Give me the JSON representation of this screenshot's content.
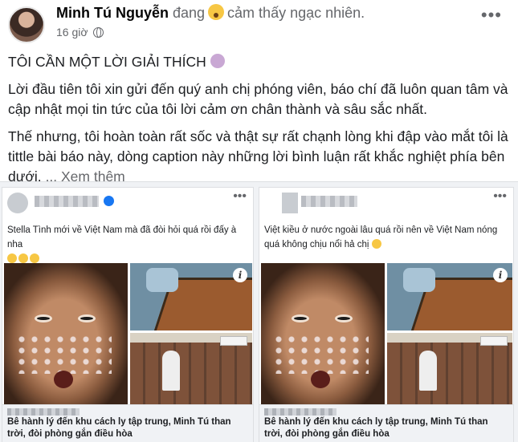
{
  "post": {
    "author": "Minh Tú Nguyễn",
    "feeling_prefix": "đang",
    "feeling_text": "cảm thấy ngạc nhiên.",
    "time": "16 giờ",
    "title": "TÔI CẦN MỘT LỜI GIẢI THÍCH",
    "paragraph1": "Lời đầu tiên tôi xin gửi đến quý anh chị phóng viên, báo chí đã luôn quan tâm và cập nhật mọi tin tức của tôi lời cảm ơn chân thành và sâu sắc nhất.",
    "paragraph2": "Thế nhưng, tôi hoàn toàn rất sốc và thật sự rất chạnh lòng khi đập vào mắt tôi là tittle bài báo này, dòng caption này những lời bình luận rất khắc nghiệt phía bên dưới.",
    "see_more": "... Xem thêm"
  },
  "cards": [
    {
      "caption": "Stella Tình mới về Việt Nam mà đã đòi hỏi quá rồi đấy à nha",
      "link_title": "Bê hành lý đến khu cách ly tập trung, Minh Tú than trời, đòi phòng gắn điều hòa"
    },
    {
      "caption": "Việt kiều ở nước ngoài lâu quá rồi nên về Việt Nam nóng quá không chịu nổi hả chị",
      "link_title": "Bê hành lý đến khu cách ly tập trung, Minh Tú than trời, đòi phòng gắn điều hòa"
    }
  ],
  "icons": {
    "more": "more-options-icon",
    "globe": "globe-icon",
    "feeling": "surprised-emoji-icon",
    "info": "info-icon"
  }
}
